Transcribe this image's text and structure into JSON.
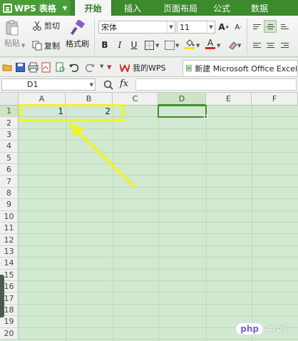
{
  "app": {
    "title": "WPS 表格",
    "tabs": [
      "开始",
      "插入",
      "页面布局",
      "公式",
      "数据"
    ],
    "active_tab": "开始"
  },
  "ribbon": {
    "paste_label": "粘贴",
    "cut_label": "剪切",
    "copy_label": "复制",
    "format_painter_label": "格式刷",
    "font_name": "宋体",
    "font_size": "11",
    "bold": "B",
    "italic": "I",
    "underline": "U",
    "grow_font": "A",
    "shrink_font": "A",
    "font_color_letter": "A",
    "highlight_color": "#f5e200",
    "font_color": "#e02020"
  },
  "quickbar": {
    "wps_tab": "我的WPS",
    "doc_tab": "新建 Microsoft Office Excel"
  },
  "formula_bar": {
    "name_box": "D1",
    "fx": "fx",
    "formula": ""
  },
  "sheet": {
    "columns": [
      "A",
      "B",
      "C",
      "D",
      "E",
      "F"
    ],
    "rows": [
      "1",
      "2",
      "3",
      "4",
      "5",
      "6",
      "7",
      "8",
      "9",
      "10",
      "11",
      "12",
      "13",
      "14",
      "15",
      "16",
      "17",
      "18",
      "19",
      "20"
    ],
    "active_column": "D",
    "active_row": "1",
    "cells": {
      "A1": "1",
      "B1": "2"
    }
  },
  "annotation": {
    "highlight_color": "#f0f22a",
    "arrow_color": "#f0f22a"
  },
  "watermark": {
    "logo": "php",
    "text": "中文网"
  },
  "colors": {
    "accent_green": "#3b8a2c",
    "grid_background": "#d1e9d1",
    "selection_border": "#3f8f2e"
  }
}
